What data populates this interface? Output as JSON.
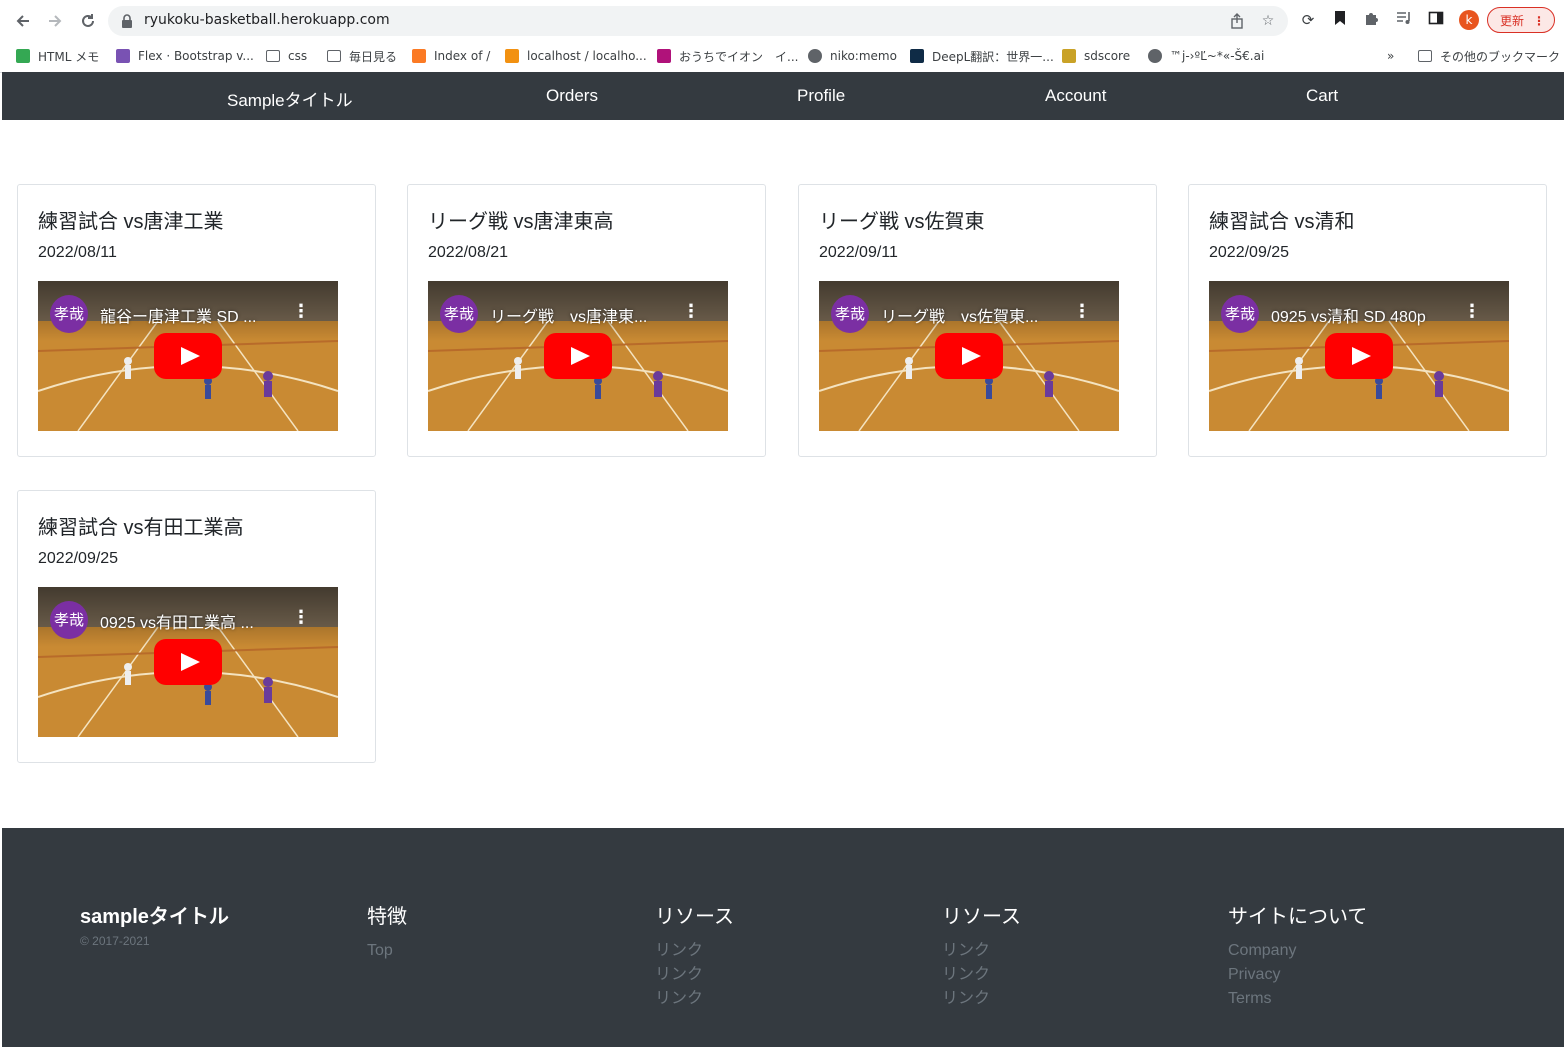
{
  "browser": {
    "url": "ryukoku-basketball.herokuapp.com",
    "update_label": "更新",
    "profile_initial": "k",
    "bookmarks": [
      {
        "label": "HTML メモ",
        "icon": "google-drive-icon",
        "color": "#34a853"
      },
      {
        "label": "Flex · Bootstrap v...",
        "icon": "bootstrap-icon",
        "color": "#7952b3"
      },
      {
        "label": "css",
        "icon": "folder-icon",
        "color": "#5f6368"
      },
      {
        "label": "毎日見る",
        "icon": "folder-icon",
        "color": "#5f6368"
      },
      {
        "label": "Index of /",
        "icon": "xampp-icon",
        "color": "#fb7a24"
      },
      {
        "label": "localhost / localho...",
        "icon": "phpmyadmin-icon",
        "color": "#f29111"
      },
      {
        "label": "おうちでイオン　イ...",
        "icon": "home-icon",
        "color": "#b0127a"
      },
      {
        "label": "niko:memo",
        "icon": "globe-icon",
        "color": "#5f6368"
      },
      {
        "label": "DeepL翻訳：世界一...",
        "icon": "deepl-icon",
        "color": "#0f2b46"
      },
      {
        "label": "sdscore",
        "icon": "crest-icon",
        "color": "#c9a227"
      },
      {
        "label": "™j-›ºĽ~*«-Š€.ai",
        "icon": "globe-icon",
        "color": "#5f6368"
      }
    ],
    "more_bookmarks": "»",
    "other_bookmarks": "その他のブックマーク"
  },
  "navbar": {
    "items": [
      "Sampleタイトル",
      "Orders",
      "Profile",
      "Account",
      "Cart"
    ]
  },
  "games": [
    {
      "title": "練習試合 vs唐津工業",
      "date": "2022/08/11",
      "channel": "孝哉",
      "video_title": "龍谷ー唐津工業 SD ..."
    },
    {
      "title": "リーグ戦 vs唐津東高",
      "date": "2022/08/21",
      "channel": "孝哉",
      "video_title": "リーグ戦　vs唐津東..."
    },
    {
      "title": "リーグ戦 vs佐賀東",
      "date": "2022/09/11",
      "channel": "孝哉",
      "video_title": "リーグ戦　vs佐賀東..."
    },
    {
      "title": "練習試合 vs清和",
      "date": "2022/09/25",
      "channel": "孝哉",
      "video_title": "0925 vs清和 SD 480p"
    },
    {
      "title": "練習試合 vs有田工業高",
      "date": "2022/09/25",
      "channel": "孝哉",
      "video_title": "0925 vs有田工業高 ..."
    }
  ],
  "footer": {
    "brand": "sampleタイトル",
    "copyright": "© 2017-2021",
    "columns": [
      {
        "heading": "特徴",
        "links": [
          "Top"
        ]
      },
      {
        "heading": "リソース",
        "links": [
          "リンク",
          "リンク",
          "リンク"
        ]
      },
      {
        "heading": "リソース",
        "links": [
          "リンク",
          "リンク",
          "リンク"
        ]
      },
      {
        "heading": "サイトについて",
        "links": [
          "Company",
          "Privacy",
          "Terms"
        ]
      }
    ]
  },
  "colors": {
    "navbar_bg": "#343a40",
    "footer_link": "#6c757d",
    "youtube_red": "#ff0000",
    "channel_avatar": "#7b2fa3"
  }
}
